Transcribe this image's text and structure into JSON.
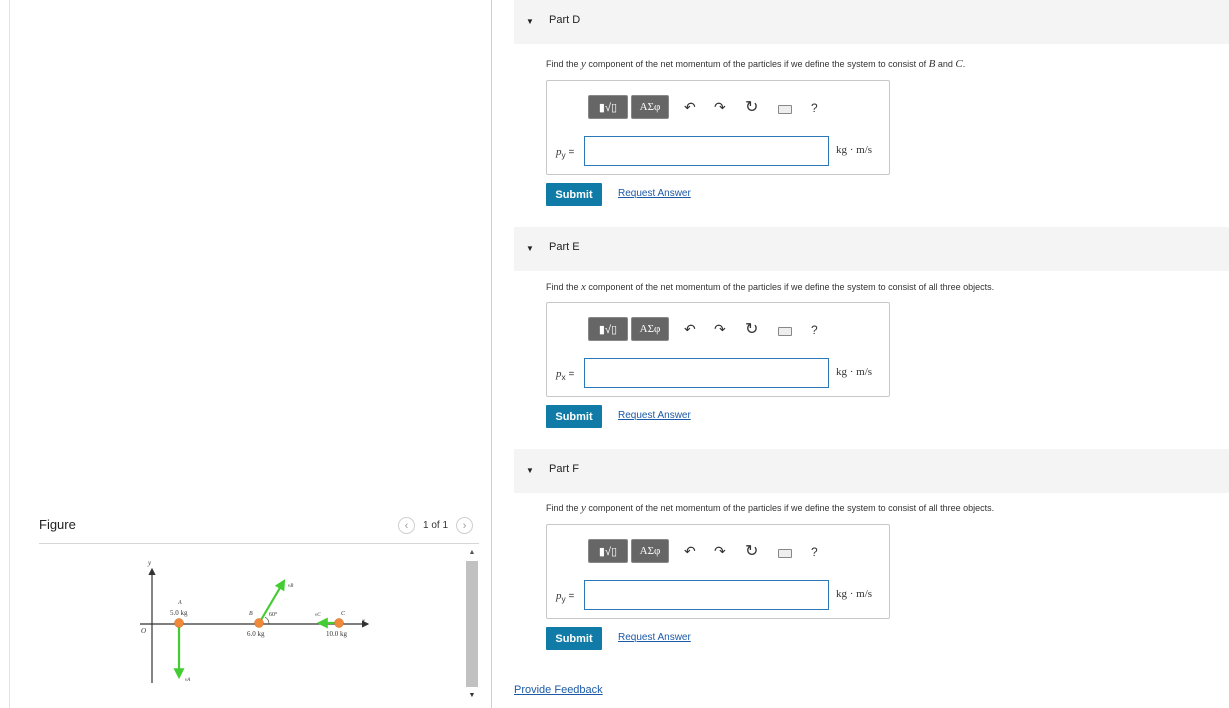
{
  "figure": {
    "title": "Figure",
    "pager_text": "1 of 1",
    "labels": {
      "y_axis": "y",
      "x_axis": "x",
      "origin": "O",
      "a_name": "A",
      "a_mass": "5.0 kg",
      "b_name": "B",
      "b_mass": "6.0 kg",
      "c_name": "C",
      "c_mass": "10.0 kg",
      "angle": "60°",
      "va": "vA",
      "vb": "vB",
      "vc": "vC"
    }
  },
  "parts": [
    {
      "title": "Part D",
      "question_pre": "Find the ",
      "question_var": "y",
      "question_mid": " component of the net momentum of the particles if we define the system to consist of ",
      "question_b": "B",
      "question_and": " and ",
      "question_c": "C",
      "question_end": ".",
      "var_label": "p",
      "var_sub": "y",
      "eq": " =",
      "unit": "kg · m/s",
      "input_value": "",
      "submit": "Submit",
      "request": "Request Answer"
    },
    {
      "title": "Part E",
      "question_pre": "Find the ",
      "question_var": "x",
      "question_mid": " component of the net momentum of the particles if we define the system to consist of all three objects.",
      "var_label": "p",
      "var_sub": "x",
      "eq": " =",
      "unit": "kg · m/s",
      "input_value": "",
      "submit": "Submit",
      "request": "Request Answer"
    },
    {
      "title": "Part F",
      "question_pre": "Find the ",
      "question_var": "y",
      "question_mid": " component of the net momentum of the particles if we define the system to consist of all three objects.",
      "var_label": "p",
      "var_sub": "y",
      "eq": " =",
      "unit": "kg · m/s",
      "input_value": "",
      "submit": "Submit",
      "request": "Request Answer"
    }
  ],
  "toolbar": {
    "templates_symbol": "▮√▯",
    "greek_symbol": "ΑΣφ",
    "undo_icon": "undo-icon",
    "redo_icon": "redo-icon",
    "reset_icon": "reset-icon",
    "keyboard_icon": "keyboard-icon",
    "help": "?"
  },
  "feedback": "Provide Feedback",
  "colors": {
    "accent": "#0f7ba6",
    "link": "#1c5aa8",
    "arrow_green": "#44cc33",
    "particle_orange": "#f08a3a"
  }
}
